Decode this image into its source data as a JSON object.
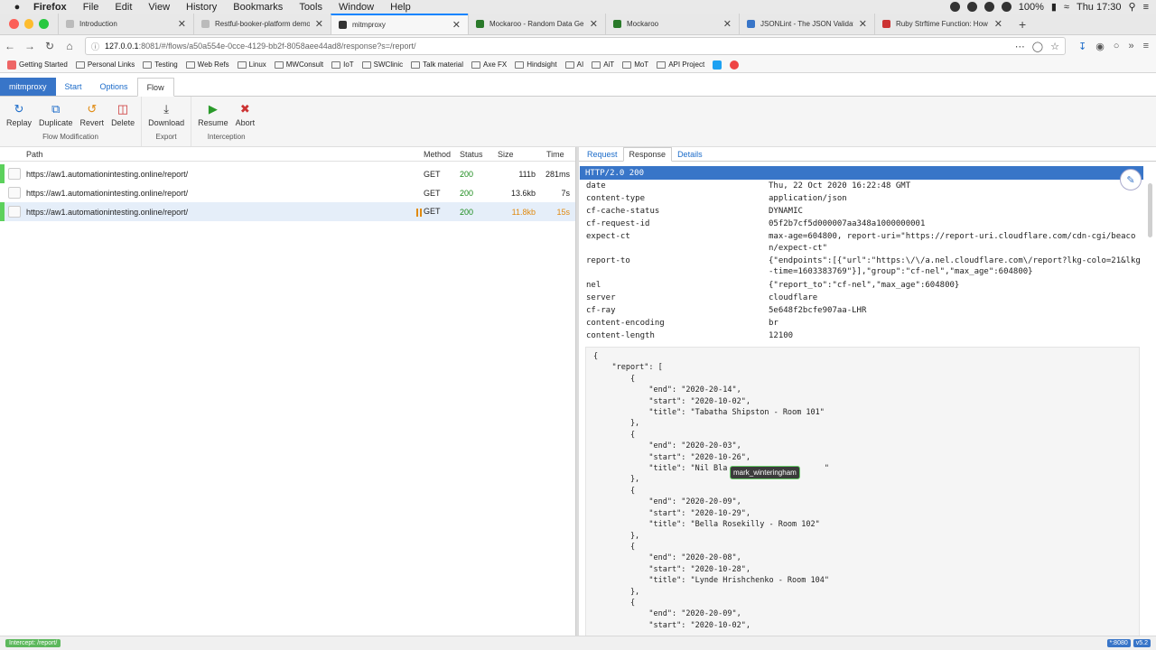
{
  "macos": {
    "app": "Firefox",
    "menus": [
      "File",
      "Edit",
      "View",
      "History",
      "Bookmarks",
      "Tools",
      "Window",
      "Help"
    ],
    "battery": "100%",
    "clock": "Thu 17:30"
  },
  "browser_tabs": [
    {
      "title": "Introduction",
      "color": "#9aa"
    },
    {
      "title": "Restful-booker-platform demo",
      "color": "#9aa"
    },
    {
      "title": "mitmproxy",
      "color": "#333"
    },
    {
      "title": "Mockaroo - Random Data Gene",
      "color": "#2a7a2a"
    },
    {
      "title": "Mockaroo",
      "color": "#2a7a2a"
    },
    {
      "title": "JSONLint - The JSON Validator",
      "color": "#3875c8"
    },
    {
      "title": "Ruby Strftime Function: How to",
      "color": "#c33"
    }
  ],
  "url": {
    "host": "127.0.0.1",
    "rest": ":8081/#/flows/a50a554e-0cce-4129-bb2f-8058aee44ad8/response?s=/report/"
  },
  "bookmarks": [
    "Getting Started",
    "Personal Links",
    "Testing",
    "Web Refs",
    "Linux",
    "MWConsult",
    "IoT",
    "SWClinic",
    "Talk material",
    "Axe FX",
    "Hindsight",
    "AI",
    "AiT",
    "MoT",
    "API Project"
  ],
  "mitm_tabs": {
    "brand": "mitmproxy",
    "start": "Start",
    "options": "Options",
    "flow": "Flow"
  },
  "toolbar": {
    "flow_modification": {
      "label": "Flow Modification",
      "buttons": [
        "Replay",
        "Duplicate",
        "Revert",
        "Delete"
      ]
    },
    "export": {
      "label": "Export",
      "buttons": [
        "Download"
      ]
    },
    "interception": {
      "label": "Interception",
      "buttons": [
        "Resume",
        "Abort"
      ]
    }
  },
  "flow_columns": {
    "path": "Path",
    "method": "Method",
    "status": "Status",
    "size": "Size",
    "time": "Time"
  },
  "flows": [
    {
      "path": "https://aw1.automationintesting.online/report/",
      "method": "GET",
      "status": "200",
      "size": "111b",
      "time": "281ms"
    },
    {
      "path": "https://aw1.automationintesting.online/report/",
      "method": "GET",
      "status": "200",
      "size": "13.6kb",
      "time": "7s"
    },
    {
      "path": "https://aw1.automationintesting.online/report/",
      "method": "GET",
      "status": "200",
      "size": "11.8kb",
      "time": "15s"
    }
  ],
  "detail_tabs": {
    "request": "Request",
    "response": "Response",
    "details": "Details"
  },
  "status_line": "HTTP/2.0 200",
  "headers": [
    {
      "name": "date",
      "value": "Thu, 22 Oct 2020 16:22:48 GMT"
    },
    {
      "name": "content-type",
      "value": "application/json"
    },
    {
      "name": "cf-cache-status",
      "value": "DYNAMIC"
    },
    {
      "name": "cf-request-id",
      "value": "05f2b7cf5d000007aa348a1000000001"
    },
    {
      "name": "expect-ct",
      "value": "max-age=604800, report-uri=\"https://report-uri.cloudflare.com/cdn-cgi/beacon/expect-ct\""
    },
    {
      "name": "report-to",
      "value": "{\"endpoints\":[{\"url\":\"https:\\/\\/a.nel.cloudflare.com\\/report?lkg-colo=21&lkg-time=1603383769\"}],\"group\":\"cf-nel\",\"max_age\":604800}"
    },
    {
      "name": "nel",
      "value": "{\"report_to\":\"cf-nel\",\"max_age\":604800}"
    },
    {
      "name": "server",
      "value": "cloudflare"
    },
    {
      "name": "cf-ray",
      "value": "5e648f2bcfe907aa-LHR"
    },
    {
      "name": "content-encoding",
      "value": "br"
    },
    {
      "name": "content-length",
      "value": "12100"
    }
  ],
  "body_text": "{\n    \"report\": [\n        {\n            \"end\": \"2020-20-14\",\n            \"start\": \"2020-10-02\",\n            \"title\": \"Tabatha Shipston - Room 101\"\n        },\n        {\n            \"end\": \"2020-20-03\",\n            \"start\": \"2020-10-26\",\n            \"title\": \"Nil Bla                     \"\n        },\n        {\n            \"end\": \"2020-20-09\",\n            \"start\": \"2020-10-29\",\n            \"title\": \"Bella Rosekilly - Room 102\"\n        },\n        {\n            \"end\": \"2020-20-08\",\n            \"start\": \"2020-10-28\",\n            \"title\": \"Lynde Hrishchenko - Room 104\"\n        },\n        {\n            \"end\": \"2020-20-09\",\n            \"start\": \"2020-10-02\",",
  "tooltip": "mark_winteringham",
  "footer": {
    "intercept": "Intercept: /report/",
    "port": "*:8080",
    "version": "v5.2"
  }
}
